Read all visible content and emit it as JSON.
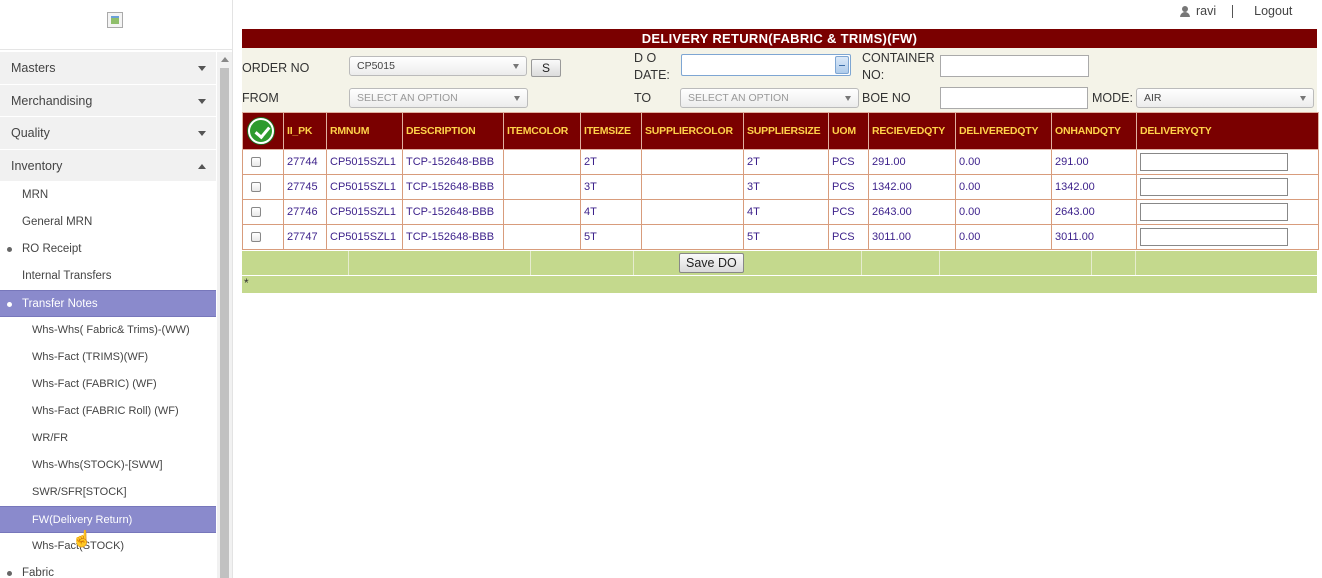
{
  "topbar": {
    "username": "ravi",
    "logout": "Logout"
  },
  "sidebar": {
    "menus": [
      {
        "label": "Masters",
        "expanded": false
      },
      {
        "label": "Merchandising",
        "expanded": false
      },
      {
        "label": "Quality",
        "expanded": false
      },
      {
        "label": "Inventory",
        "expanded": true
      }
    ],
    "inventory_items": [
      "MRN",
      "General MRN",
      "RO Receipt",
      "Internal Transfers",
      "Transfer Notes"
    ],
    "transfer_notes_items": [
      "Whs-Whs( Fabric& Trims)-(WW)",
      "Whs-Fact (TRIMS)(WF)",
      "Whs-Fact (FABRIC) (WF)",
      "Whs-Fact (FABRIC Roll) (WF)",
      "WR/FR",
      "Whs-Whs(STOCK)-[SWW]",
      "SWR/SFR[STOCK]",
      "FW(Delivery Return)",
      "Whs-Fact(STOCK)"
    ],
    "next_item": "Fabric"
  },
  "page": {
    "title": "DELIVERY RETURN(FABRIC & TRIMS)(FW)"
  },
  "form": {
    "order_no_label": "ORDER NO",
    "order_no_value": "CP5015",
    "s_button": "S",
    "do_date_label_1": "D O",
    "do_date_label_2": "DATE:",
    "container_label_1": "CONTAINER",
    "container_label_2": "NO:",
    "from_label": "FROM",
    "from_placeholder": "SELECT AN OPTION",
    "to_label": "TO",
    "to_placeholder": "SELECT AN OPTION",
    "boe_label": "BOE NO",
    "mode_label": "MODE:",
    "mode_value": "AIR"
  },
  "table": {
    "headers": [
      "II_PK",
      "RMNUM",
      "DESCRIPTION",
      "ITEMCOLOR",
      "ITEMSIZE",
      "SUPPLIERCOLOR",
      "SUPPLIERSIZE",
      "UOM",
      "RECIEVEDQTY",
      "DELIVEREDQTY",
      "ONHANDQTY",
      "DELIVERYQTY"
    ],
    "rows": [
      {
        "ii_pk": "27744",
        "rmnum": "CP5015SZL1",
        "description": "TCP-152648-BBB",
        "itemcolor": "",
        "itemsize": "2T",
        "suppliercolor": "",
        "suppliersize": "2T",
        "uom": "PCS",
        "recievedqty": "291.00",
        "deliveredqty": "0.00",
        "onhandqty": "291.00"
      },
      {
        "ii_pk": "27745",
        "rmnum": "CP5015SZL1",
        "description": "TCP-152648-BBB",
        "itemcolor": "",
        "itemsize": "3T",
        "suppliercolor": "",
        "suppliersize": "3T",
        "uom": "PCS",
        "recievedqty": "1342.00",
        "deliveredqty": "0.00",
        "onhandqty": "1342.00"
      },
      {
        "ii_pk": "27746",
        "rmnum": "CP5015SZL1",
        "description": "TCP-152648-BBB",
        "itemcolor": "",
        "itemsize": "4T",
        "suppliercolor": "",
        "suppliersize": "4T",
        "uom": "PCS",
        "recievedqty": "2643.00",
        "deliveredqty": "0.00",
        "onhandqty": "2643.00"
      },
      {
        "ii_pk": "27747",
        "rmnum": "CP5015SZL1",
        "description": "TCP-152648-BBB",
        "itemcolor": "",
        "itemsize": "5T",
        "suppliercolor": "",
        "suppliersize": "5T",
        "uom": "PCS",
        "recievedqty": "3011.00",
        "deliveredqty": "0.00",
        "onhandqty": "3011.00"
      }
    ]
  },
  "footer": {
    "save_label": "Save DO",
    "note": "*"
  },
  "colors": {
    "header_bg": "#7a0000",
    "header_text": "#ffd24a",
    "footer_bg": "#c4d98d",
    "active_menu": "#8a8acc"
  }
}
